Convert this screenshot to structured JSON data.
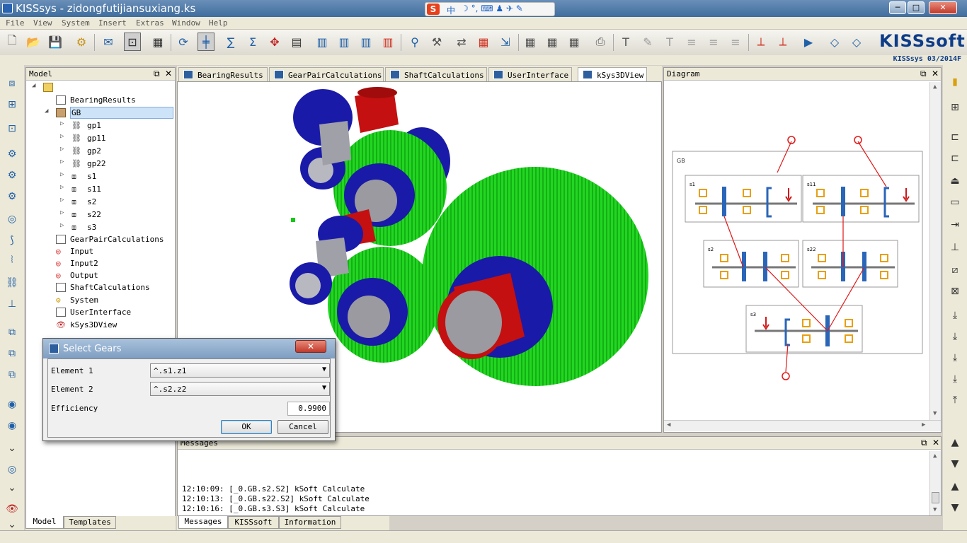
{
  "window": {
    "title": "KISSsys - zidongfutijiansuxiang.ks",
    "minimize": "─",
    "maximize": "□",
    "close": "✕"
  },
  "ime": {
    "logo": "S",
    "mode": "中"
  },
  "menu": [
    "File",
    "View",
    "System",
    "Insert",
    "Extras",
    "Window",
    "Help"
  ],
  "brand": {
    "logo": "KISSsoft",
    "version": "KISSsys 03/2014F"
  },
  "model_panel": {
    "title": "Model",
    "tree": [
      {
        "label": "",
        "level": 0,
        "icon": "folder",
        "expanded": true
      },
      {
        "label": "BearingResults",
        "level": 1,
        "icon": "table"
      },
      {
        "label": "GB",
        "level": 1,
        "icon": "gearbox",
        "expanded": true,
        "selected": true
      },
      {
        "label": "gp1",
        "level": 2,
        "icon": "gearpair"
      },
      {
        "label": "gp11",
        "level": 2,
        "icon": "gearpair"
      },
      {
        "label": "gp2",
        "level": 2,
        "icon": "gearpair"
      },
      {
        "label": "gp22",
        "level": 2,
        "icon": "gearpair"
      },
      {
        "label": "s1",
        "level": 2,
        "icon": "shaft"
      },
      {
        "label": "s11",
        "level": 2,
        "icon": "shaft"
      },
      {
        "label": "s2",
        "level": 2,
        "icon": "shaft"
      },
      {
        "label": "s22",
        "level": 2,
        "icon": "shaft"
      },
      {
        "label": "s3",
        "level": 2,
        "icon": "shaft"
      },
      {
        "label": "GearPairCalculations",
        "level": 1,
        "icon": "table"
      },
      {
        "label": "Input",
        "level": 1,
        "icon": "io"
      },
      {
        "label": "Input2",
        "level": 1,
        "icon": "io"
      },
      {
        "label": "Output",
        "level": 1,
        "icon": "io"
      },
      {
        "label": "ShaftCalculations",
        "level": 1,
        "icon": "table"
      },
      {
        "label": "System",
        "level": 1,
        "icon": "system"
      },
      {
        "label": "UserInterface",
        "level": 1,
        "icon": "table"
      },
      {
        "label": "kSys3DView",
        "level": 1,
        "icon": "eye"
      }
    ],
    "tabs": [
      "Model",
      "Templates"
    ]
  },
  "doc_tabs": [
    "BearingResults",
    "GearPairCalculations",
    "ShaftCalculations",
    "UserInterface",
    "kSys3DView"
  ],
  "active_doc_tab": "kSys3DView",
  "diagram_panel": {
    "title": "Diagram",
    "group_label": "GB",
    "shafts": [
      "s1",
      "s11",
      "s2",
      "s22",
      "s3"
    ]
  },
  "messages_panel": {
    "title": "Messages",
    "lines": [
      "12:10:09: [_0.GB.s2.S2] kSoft Calculate",
      "12:10:13: [_0.GB.s22.S2] kSoft Calculate",
      "12:10:16: [_0.GB.s3.S3] kSoft Calculate"
    ],
    "tabs": [
      "Messages",
      "KISSsoft",
      "Information"
    ]
  },
  "dialog": {
    "title": "Select Gears",
    "element1_label": "Element 1",
    "element1_value": "^.s1.z1",
    "element2_label": "Element 2",
    "element2_value": "^.s2.z2",
    "efficiency_label": "Efficiency",
    "efficiency_value": "0.9900",
    "ok": "OK",
    "cancel": "Cancel",
    "close": "✕"
  },
  "colors": {
    "gear_green": "#1fd21f",
    "shaft_red": "#c41010",
    "hub_blue": "#1a1aa8",
    "diagram_red": "#e01818",
    "bearing_orange": "#f0a020"
  }
}
